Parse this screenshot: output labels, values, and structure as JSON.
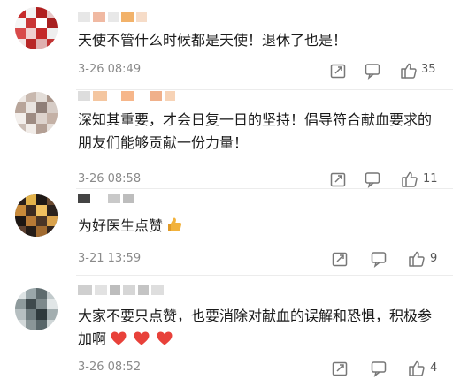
{
  "comments": [
    {
      "text": "天使不管什么时候都是天使！退休了也是！",
      "time": "3-26 08:49",
      "likes": "35"
    },
    {
      "text": "深知其重要，才会日复一日的坚持！倡导符合献血要求的朋友们能够贡献一份力量！",
      "time": "3-26 08:58",
      "likes": "11"
    },
    {
      "text": "为好医生点赞",
      "time": "3-21 13:59",
      "likes": "9"
    },
    {
      "text": "大家不要只点赞，也要消除对献血的误解和恐惧，积极参加啊",
      "time": "3-26 08:52",
      "likes": "4"
    }
  ],
  "icons": {
    "share": "share-icon",
    "comment": "comment-icon",
    "like": "thumbs-up-icon",
    "emoji_thumb": "thumbs-up-emoji-icon",
    "emoji_heart": "heart-emoji-icon"
  },
  "colors": {
    "text": "#1a1a1a",
    "meta": "#8a8a8a",
    "heart": "#e8413a",
    "thumb": "#f2b23c"
  }
}
